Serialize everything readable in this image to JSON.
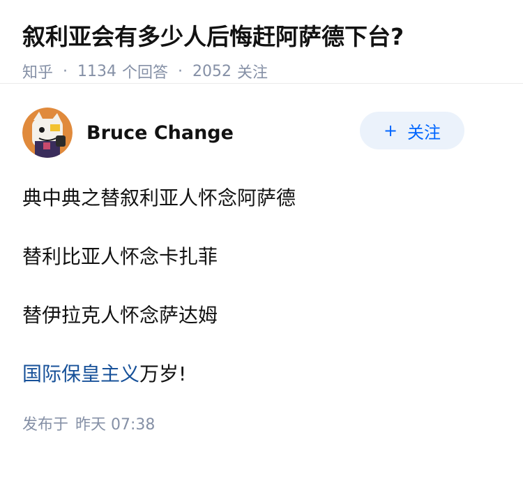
{
  "question": {
    "title": "叙利亚会有多少人后悔赶阿萨德下台?",
    "source": "知乎",
    "answer_count": "1134",
    "answer_label": "个回答",
    "follow_count": "2052",
    "follow_label": "关注"
  },
  "answer": {
    "author_name": "Bruce Change",
    "follow_button_plus": "+",
    "follow_button_label": "关注",
    "paragraphs": [
      "典中典之替叙利亚人怀念阿萨德",
      "替利比亚人怀念卡扎菲",
      "替伊拉克人怀念萨达姆"
    ],
    "last_paragraph_link": "国际保皇主义",
    "last_paragraph_rest": "万岁!",
    "published_label": "发布于",
    "published_time": "昨天 07:38"
  },
  "colors": {
    "meta_gray": "#8590a6",
    "link_blue": "#175199",
    "brand_blue": "#0066ff",
    "follow_bg": "#ebf2fb"
  },
  "icons": {
    "avatar": "cartoon-cat-avatar"
  }
}
